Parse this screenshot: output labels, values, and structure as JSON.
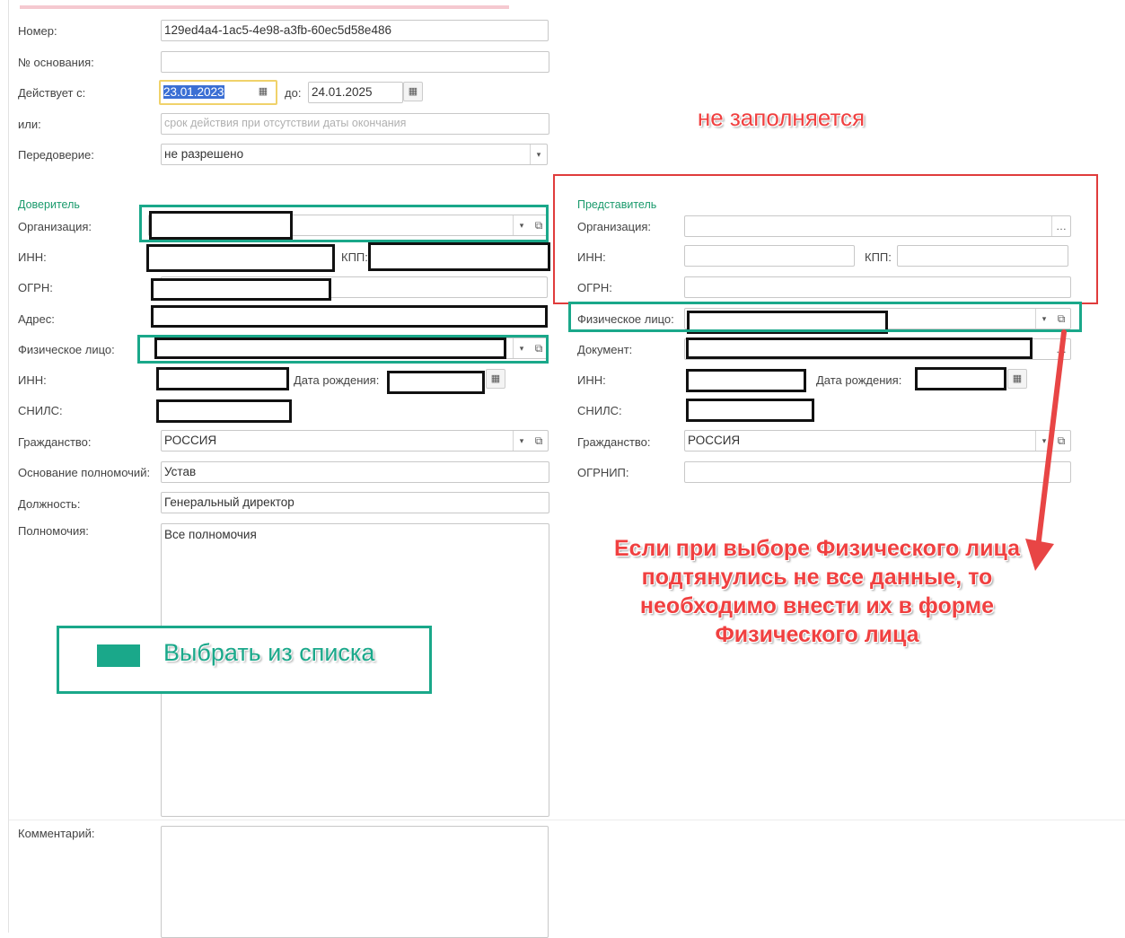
{
  "form": {
    "number_label": "Номер:",
    "number_value": "129ed4a4-1ac5-4e98-a3fb-60ec5d58e486",
    "basis_no_label": "№ основания:",
    "basis_no_value": "",
    "valid_from_label": "Действует с:",
    "valid_from_value": "23.01.2023",
    "valid_to_label": "до:",
    "valid_to_value": "24.01.2025",
    "or_label": "или:",
    "or_placeholder": "срок действия при отсутствии даты окончания",
    "redelegation_label": "Передоверие:",
    "redelegation_value": "не разрешено"
  },
  "principal": {
    "section_title": "Доверитель",
    "org_label": "Организация:",
    "inn_label": "ИНН:",
    "kpp_label": "КПП:",
    "ogrn_label": "ОГРН:",
    "address_label": "Адрес:",
    "person_label": "Физическое лицо:",
    "person_inn_label": "ИНН:",
    "birth_label": "Дата рождения:",
    "snils_label": "СНИЛС:",
    "citizenship_label": "Гражданство:",
    "citizenship_value": "РОССИЯ",
    "authority_basis_label": "Основание полномочий:",
    "authority_basis_value": "Устав",
    "position_label": "Должность:",
    "position_value": "Генеральный директор",
    "powers_label": "Полномочия:",
    "powers_value": "Все полномочия",
    "comment_label": "Комментарий:"
  },
  "representative": {
    "section_title": "Представитель",
    "org_label": "Организация:",
    "inn_label": "ИНН:",
    "kpp_label": "КПП:",
    "ogrn_label": "ОГРН:",
    "person_label": "Физическое лицо:",
    "document_label": "Документ:",
    "person_inn_label": "ИНН:",
    "birth_label": "Дата рождения:",
    "snils_label": "СНИЛС:",
    "citizenship_label": "Гражданство:",
    "citizenship_value": "РОССИЯ",
    "ogrnip_label": "ОГРНИП:"
  },
  "annotations": {
    "not_filled": "не заполняется",
    "select_from_list": "Выбрать из списка",
    "hint": "Если при выборе Физического лица подтянулись не все данные, то необходимо внести их в форме Физического лица"
  },
  "icons": {
    "dropdown": "chevron-down-icon",
    "open": "open-form-icon",
    "calendar": "calendar-icon",
    "more": "ellipsis-icon"
  },
  "colors": {
    "green_annotation": "#1aa88a",
    "red_annotation": "#e03c3c",
    "date_highlight": "#3b6fd4"
  }
}
